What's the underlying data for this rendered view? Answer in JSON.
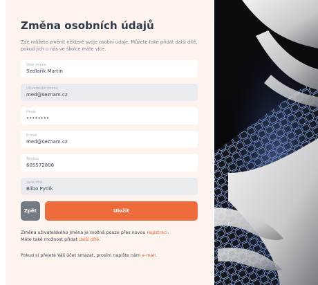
{
  "form": {
    "title": "Změna osobních údajů",
    "intro": "Zde můžete změnit některé svoje osobní údaje. Můžete také přidat další dítě, pokud jich u nás ve školce máte více.",
    "fields": [
      {
        "label": "Vaše jméno",
        "value": "Sedlařík Martin"
      },
      {
        "label": "Uživatelské jméno",
        "value": "med@seznam.cz"
      },
      {
        "label": "Heslo",
        "value": "••••••••"
      },
      {
        "label": "E-mail",
        "value": "med@seznam.cz"
      },
      {
        "label": "Telefon",
        "value": "605572808"
      },
      {
        "label": "Vaše dítě",
        "value": "Bilbo Pytlík"
      }
    ],
    "back_label": "Zpět",
    "save_label": "Uložit"
  },
  "notes": {
    "username_text": "Změna uživatelského jména je možná pouze přes novou",
    "username_link": "registraci",
    "child_text": "Máte také možnost přidat",
    "child_link": "další dítě",
    "delete_text": "Pokud si přejete Váš účet smazat, prosím napište nám",
    "delete_link": "e-mail"
  },
  "colors": {
    "accent": "#ee6b3c",
    "panel_bg": "#fdf3ef",
    "back_button": "#737a82"
  }
}
